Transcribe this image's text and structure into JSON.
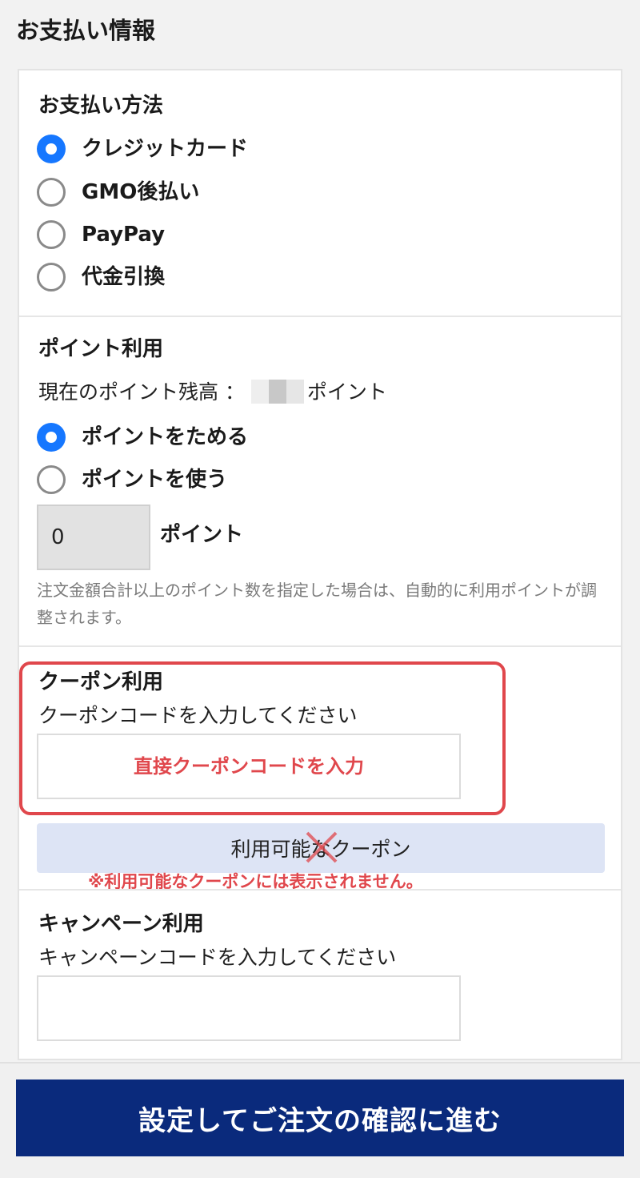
{
  "page": {
    "title": "お支払い情報"
  },
  "payment": {
    "title": "お支払い方法",
    "options": [
      {
        "label": "クレジットカード",
        "selected": true
      },
      {
        "label": "GMO後払い",
        "selected": false
      },
      {
        "label": "PayPay",
        "selected": false
      },
      {
        "label": "代金引換",
        "selected": false
      }
    ]
  },
  "points": {
    "title": "ポイント利用",
    "balance_label": "現在のポイント残高 ：",
    "balance_unit": "ポイント",
    "options": [
      {
        "label": "ポイントをためる",
        "selected": true
      },
      {
        "label": "ポイントを使う",
        "selected": false
      }
    ],
    "input_value": "0",
    "input_unit": "ポイント",
    "note": "注文金額合計以上のポイント数を指定した場合は、自動的に利用ポイントが調整されます。"
  },
  "coupon": {
    "title": "クーポン利用",
    "instruction": "クーポンコードを入力してください",
    "input_placeholder": "直接クーポンコードを入力",
    "available_button": "利用可能なクーポン",
    "warning": "※利用可能なクーポンには表示されません。"
  },
  "campaign": {
    "title": "キャンペーン利用",
    "instruction": "キャンペーンコードを入力してください",
    "input_value": ""
  },
  "footer": {
    "submit_label": "設定してご注文の確認に進む"
  },
  "colors": {
    "accent": "#1677ff",
    "primary_button": "#0a2a7c",
    "highlight": "#e0474c"
  }
}
